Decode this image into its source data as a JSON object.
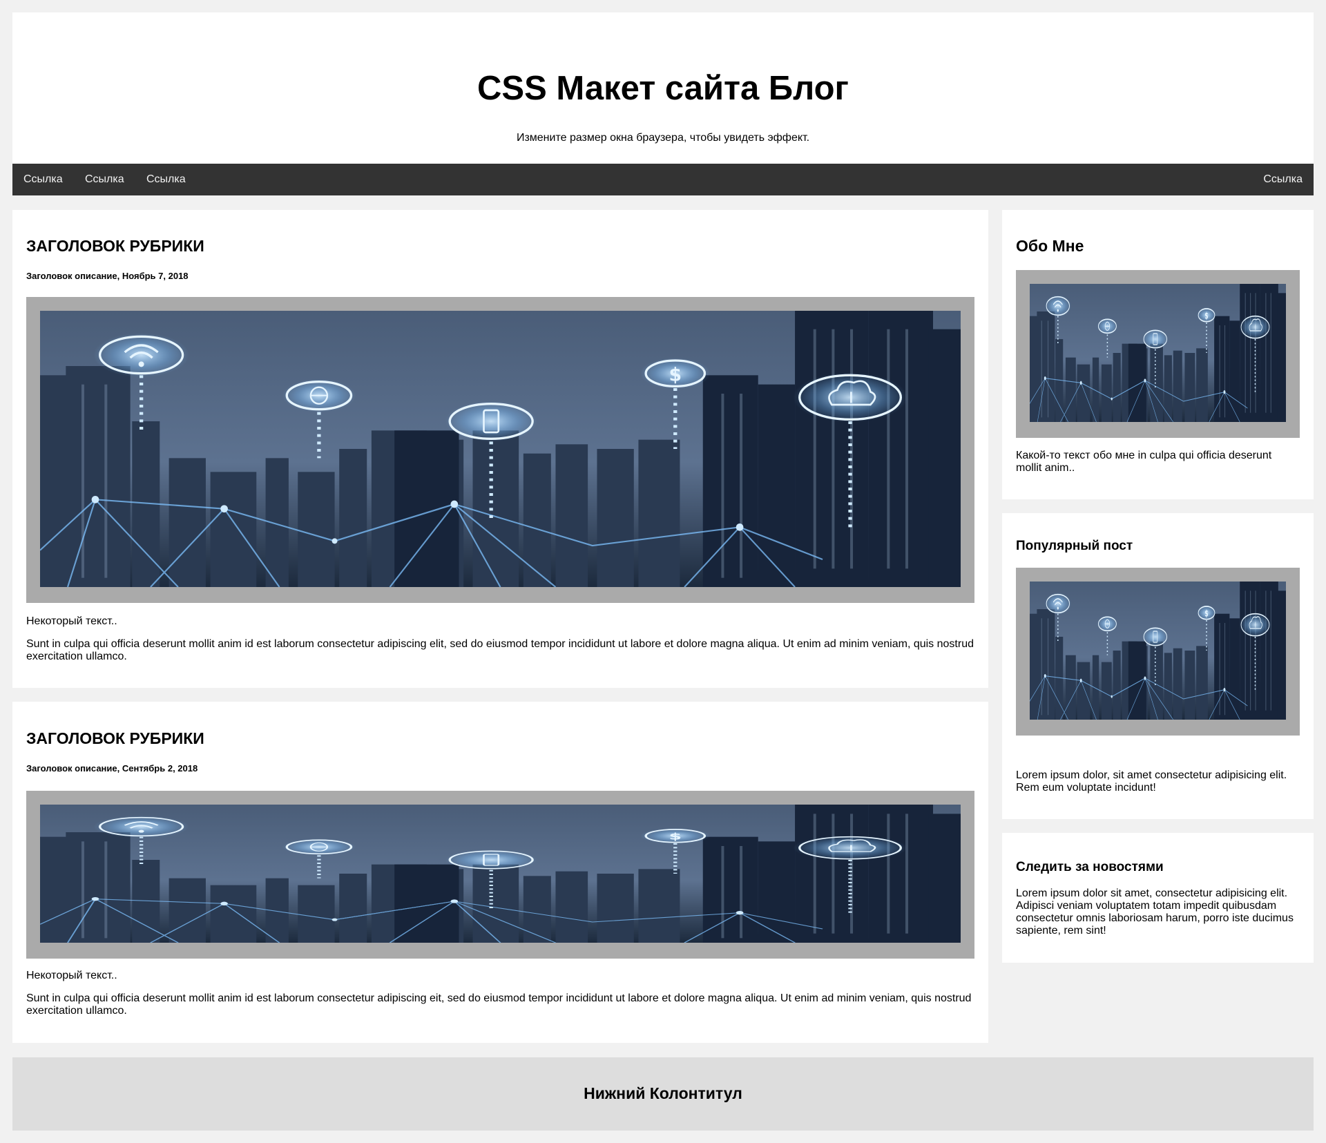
{
  "header": {
    "title": "CSS Макет сайта Блог",
    "subtitle": "Измените размер окна браузера, чтобы увидеть эффект."
  },
  "topnav": {
    "links": [
      "Ссылка",
      "Ссылка",
      "Ссылка"
    ],
    "right_link": "Ссылка"
  },
  "posts": [
    {
      "heading": "ЗАГОЛОВОК РУБРИКИ",
      "meta": "Заголовок описание, Ноябрь 7, 2018",
      "lead": "Некоторый текст..",
      "body": "Sunt in culpa qui officia deserunt mollit anim id est laborum consectetur adipiscing elit, sed do eiusmod tempor incididunt ut labore et dolore magna aliqua. Ut enim ad minim veniam, quis nostrud exercitation ullamco."
    },
    {
      "heading": "ЗАГОЛОВОК РУБРИКИ",
      "meta": "Заголовок описание, Сентябрь 2, 2018",
      "lead": "Некоторый текст..",
      "body": "Sunt in culpa qui officia deserunt mollit anim id est laborum consectetur adipiscing eit, sed do eiusmod tempor incididunt ut labore et dolore magna aliqua. Ut enim ad minim veniam, quis nostrud exercitation ullamco."
    }
  ],
  "sidebar": {
    "about": {
      "heading": "Обо Мне",
      "text": "Какой-то текст обо мне in culpa qui officia deserunt mollit anim.."
    },
    "popular": {
      "heading": "Популярный пост",
      "text": "Lorem ipsum dolor, sit amet consectetur adipisicing elit. Rem eum voluptate incidunt!"
    },
    "follow": {
      "heading": "Следить за новостями",
      "text": "Lorem ipsum dolor sit amet, consectetur adipisicing elit. Adipisci veniam voluptatem totam impedit quibusdam consectetur omnis laboriosam harum, porro iste ducimus sapiente, rem sint!"
    }
  },
  "footer": {
    "title": "Нижний Колонтитул"
  },
  "colors": {
    "page_bg": "#f1f1f1",
    "card_bg": "#ffffff",
    "nav_bg": "#333333",
    "nav_text": "#f2f2f2",
    "image_frame": "#aaaaaa",
    "footer_bg": "#dddddd"
  },
  "images": {
    "city_network": "smart-city-skyline-image"
  }
}
